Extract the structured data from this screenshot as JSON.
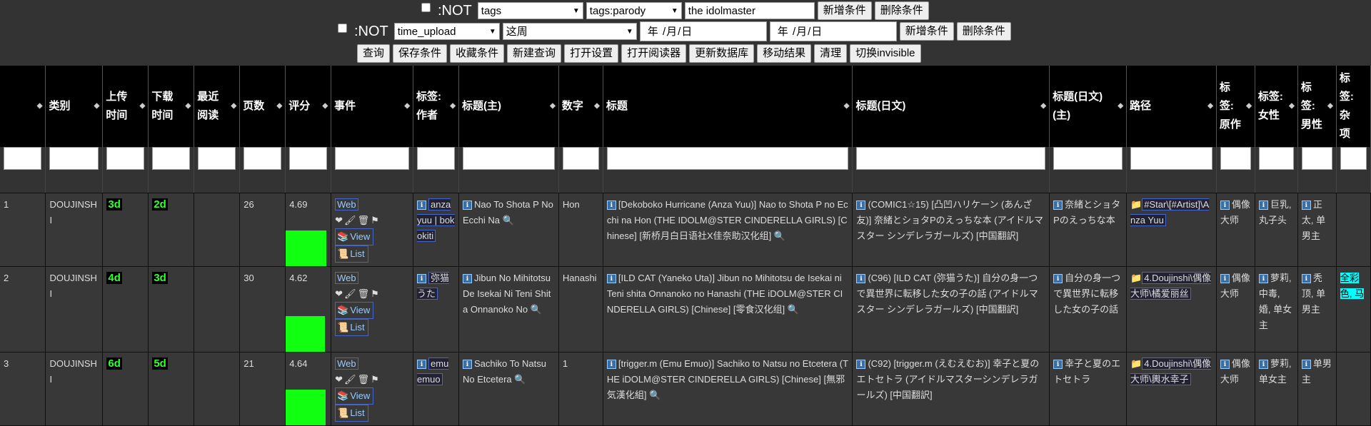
{
  "filters": {
    "row1": {
      "not_label": ":NOT",
      "field": "tags",
      "value_select": "tags:parody",
      "text": "the idolmaster",
      "add": "新增条件",
      "del": "删除条件"
    },
    "row2": {
      "not_label": ":NOT",
      "field": "time_upload",
      "value_select": "这周",
      "date1": "年  /月/日",
      "date2": "年  /月/日",
      "add": "新增条件",
      "del": "删除条件"
    },
    "buttons": [
      "查询",
      "保存条件",
      "收藏条件",
      "新建查询",
      "打开设置",
      "打开阅读器",
      "更新数据库",
      "移动结果",
      "清理",
      "切换invisible"
    ]
  },
  "columns": [
    "类别",
    "上传时间",
    "下载时间",
    "最近阅读",
    "页数",
    "评分",
    "事件",
    "标签:作者",
    "标题(主)",
    "数字",
    "标题",
    "标题(日文)",
    "标题(日文)(主)",
    "路径",
    "标签:原作",
    "标签:女性",
    "标签:男性",
    "标签:杂项"
  ],
  "rows": [
    {
      "idx": "1",
      "cat": "DOUJINSHI",
      "up": "3d",
      "down": "2d",
      "pages": "26",
      "rating": "4.69",
      "rating_fill": 0.94,
      "author": "anza yuu | bokokiti",
      "main": "Nao To Shota P No Ecchi Na",
      "num": "Hon",
      "title": "[Dekoboko Hurricane (Anza Yuu)] Nao to Shota P no Ecchi na Hon (THE IDOLM@STER CINDERELLA GIRLS) [Chinese] [新桥月白日语社X佳奈助汉化组]",
      "jtitle": "(COMIC1☆15) [凸凹ハリケーン (あんざ友)] 奈緒とショタPのえっちな本 (アイドルマスター シンデレラガールズ) [中国翻訳]",
      "jmain": "奈緒とショタPのえっちな本",
      "path": "#Star\\[#Artist]\\Anza Yuu",
      "parody": "偶像大师",
      "female": "巨乳, 丸子头",
      "male": "正太, 单男主",
      "misc": ""
    },
    {
      "idx": "2",
      "cat": "DOUJINSHI",
      "up": "4d",
      "down": "3d",
      "pages": "30",
      "rating": "4.62",
      "rating_fill": 0.92,
      "author": "弥猫うた",
      "main": "Jibun No Mihitotsu De Isekai Ni Teni Shita Onnanoko No",
      "num": "Hanashi",
      "title": "[ILD CAT (Yaneko Uta)] Jibun no Mihitotsu de Isekai ni Teni shita Onnanoko no Hanashi (THE iDOLM@STER CINDERELLA GIRLS) [Chinese] [零食汉化组]",
      "jtitle": "(C96) [ILD CAT (弥猫うた)] 自分の身一つで異世界に転移した女の子の話 (アイドルマスター シンデレラガールズ) [中国翻訳]",
      "jmain": "自分の身一つで異世界に転移した女の子の話",
      "path": "4.Doujinshi\\偶像大师\\橘爱丽丝",
      "parody": "偶像大师",
      "female": "萝莉, 中毒, 婚, 单女主",
      "male": "秃顶, 单男主",
      "misc": "全彩色, 马"
    },
    {
      "idx": "3",
      "cat": "DOUJINSHI",
      "up": "6d",
      "down": "5d",
      "pages": "21",
      "rating": "4.64",
      "rating_fill": 0.93,
      "author": "emu emuo",
      "main": "Sachiko To Natsu No Etcetera",
      "num": "1",
      "title": "[trigger.m (Emu Emuo)] Sachiko to Natsu no Etcetera (THE iDOLM@STER CINDERELLA GIRLS) [Chinese] [無邪気漢化組]",
      "jtitle": "(C92) [trigger.m (えむえむお)] 幸子と夏のエトセトラ (アイドルマスターシンデレラガールズ) [中国翻訳]",
      "jmain": "幸子と夏のエトセトラ",
      "path": "4.Doujinshi\\偶像大师\\輿水幸子",
      "parody": "偶像大师",
      "female": "萝莉, 单女主",
      "male": "单男主",
      "misc": ""
    }
  ],
  "event": {
    "web": "Web",
    "view": "View",
    "list": "List"
  }
}
